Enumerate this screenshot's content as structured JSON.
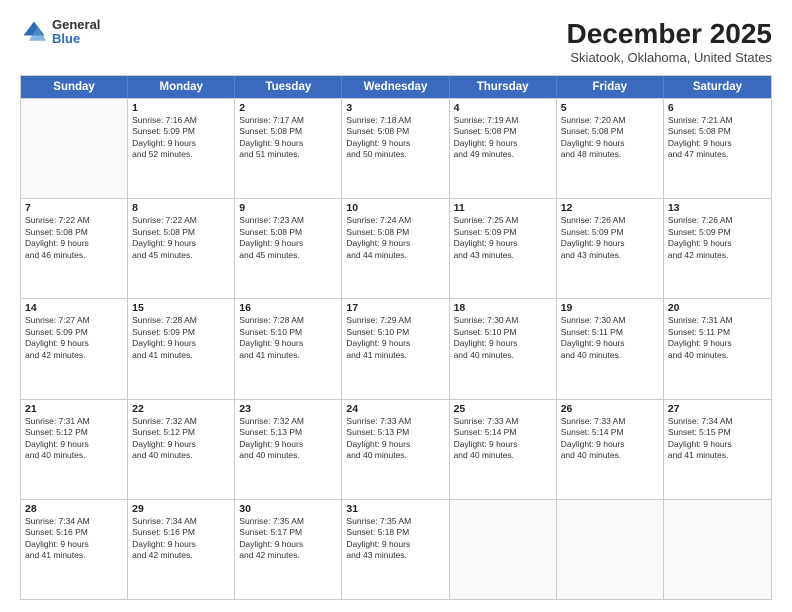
{
  "header": {
    "logo": {
      "general": "General",
      "blue": "Blue"
    },
    "title": "December 2025",
    "location": "Skiatook, Oklahoma, United States"
  },
  "weekdays": [
    "Sunday",
    "Monday",
    "Tuesday",
    "Wednesday",
    "Thursday",
    "Friday",
    "Saturday"
  ],
  "rows": [
    [
      {
        "day": "",
        "lines": []
      },
      {
        "day": "1",
        "lines": [
          "Sunrise: 7:16 AM",
          "Sunset: 5:09 PM",
          "Daylight: 9 hours",
          "and 52 minutes."
        ]
      },
      {
        "day": "2",
        "lines": [
          "Sunrise: 7:17 AM",
          "Sunset: 5:08 PM",
          "Daylight: 9 hours",
          "and 51 minutes."
        ]
      },
      {
        "day": "3",
        "lines": [
          "Sunrise: 7:18 AM",
          "Sunset: 5:08 PM",
          "Daylight: 9 hours",
          "and 50 minutes."
        ]
      },
      {
        "day": "4",
        "lines": [
          "Sunrise: 7:19 AM",
          "Sunset: 5:08 PM",
          "Daylight: 9 hours",
          "and 49 minutes."
        ]
      },
      {
        "day": "5",
        "lines": [
          "Sunrise: 7:20 AM",
          "Sunset: 5:08 PM",
          "Daylight: 9 hours",
          "and 48 minutes."
        ]
      },
      {
        "day": "6",
        "lines": [
          "Sunrise: 7:21 AM",
          "Sunset: 5:08 PM",
          "Daylight: 9 hours",
          "and 47 minutes."
        ]
      }
    ],
    [
      {
        "day": "7",
        "lines": [
          "Sunrise: 7:22 AM",
          "Sunset: 5:08 PM",
          "Daylight: 9 hours",
          "and 46 minutes."
        ]
      },
      {
        "day": "8",
        "lines": [
          "Sunrise: 7:22 AM",
          "Sunset: 5:08 PM",
          "Daylight: 9 hours",
          "and 45 minutes."
        ]
      },
      {
        "day": "9",
        "lines": [
          "Sunrise: 7:23 AM",
          "Sunset: 5:08 PM",
          "Daylight: 9 hours",
          "and 45 minutes."
        ]
      },
      {
        "day": "10",
        "lines": [
          "Sunrise: 7:24 AM",
          "Sunset: 5:08 PM",
          "Daylight: 9 hours",
          "and 44 minutes."
        ]
      },
      {
        "day": "11",
        "lines": [
          "Sunrise: 7:25 AM",
          "Sunset: 5:09 PM",
          "Daylight: 9 hours",
          "and 43 minutes."
        ]
      },
      {
        "day": "12",
        "lines": [
          "Sunrise: 7:26 AM",
          "Sunset: 5:09 PM",
          "Daylight: 9 hours",
          "and 43 minutes."
        ]
      },
      {
        "day": "13",
        "lines": [
          "Sunrise: 7:26 AM",
          "Sunset: 5:09 PM",
          "Daylight: 9 hours",
          "and 42 minutes."
        ]
      }
    ],
    [
      {
        "day": "14",
        "lines": [
          "Sunrise: 7:27 AM",
          "Sunset: 5:09 PM",
          "Daylight: 9 hours",
          "and 42 minutes."
        ]
      },
      {
        "day": "15",
        "lines": [
          "Sunrise: 7:28 AM",
          "Sunset: 5:09 PM",
          "Daylight: 9 hours",
          "and 41 minutes."
        ]
      },
      {
        "day": "16",
        "lines": [
          "Sunrise: 7:28 AM",
          "Sunset: 5:10 PM",
          "Daylight: 9 hours",
          "and 41 minutes."
        ]
      },
      {
        "day": "17",
        "lines": [
          "Sunrise: 7:29 AM",
          "Sunset: 5:10 PM",
          "Daylight: 9 hours",
          "and 41 minutes."
        ]
      },
      {
        "day": "18",
        "lines": [
          "Sunrise: 7:30 AM",
          "Sunset: 5:10 PM",
          "Daylight: 9 hours",
          "and 40 minutes."
        ]
      },
      {
        "day": "19",
        "lines": [
          "Sunrise: 7:30 AM",
          "Sunset: 5:11 PM",
          "Daylight: 9 hours",
          "and 40 minutes."
        ]
      },
      {
        "day": "20",
        "lines": [
          "Sunrise: 7:31 AM",
          "Sunset: 5:11 PM",
          "Daylight: 9 hours",
          "and 40 minutes."
        ]
      }
    ],
    [
      {
        "day": "21",
        "lines": [
          "Sunrise: 7:31 AM",
          "Sunset: 5:12 PM",
          "Daylight: 9 hours",
          "and 40 minutes."
        ]
      },
      {
        "day": "22",
        "lines": [
          "Sunrise: 7:32 AM",
          "Sunset: 5:12 PM",
          "Daylight: 9 hours",
          "and 40 minutes."
        ]
      },
      {
        "day": "23",
        "lines": [
          "Sunrise: 7:32 AM",
          "Sunset: 5:13 PM",
          "Daylight: 9 hours",
          "and 40 minutes."
        ]
      },
      {
        "day": "24",
        "lines": [
          "Sunrise: 7:33 AM",
          "Sunset: 5:13 PM",
          "Daylight: 9 hours",
          "and 40 minutes."
        ]
      },
      {
        "day": "25",
        "lines": [
          "Sunrise: 7:33 AM",
          "Sunset: 5:14 PM",
          "Daylight: 9 hours",
          "and 40 minutes."
        ]
      },
      {
        "day": "26",
        "lines": [
          "Sunrise: 7:33 AM",
          "Sunset: 5:14 PM",
          "Daylight: 9 hours",
          "and 40 minutes."
        ]
      },
      {
        "day": "27",
        "lines": [
          "Sunrise: 7:34 AM",
          "Sunset: 5:15 PM",
          "Daylight: 9 hours",
          "and 41 minutes."
        ]
      }
    ],
    [
      {
        "day": "28",
        "lines": [
          "Sunrise: 7:34 AM",
          "Sunset: 5:16 PM",
          "Daylight: 9 hours",
          "and 41 minutes."
        ]
      },
      {
        "day": "29",
        "lines": [
          "Sunrise: 7:34 AM",
          "Sunset: 5:16 PM",
          "Daylight: 9 hours",
          "and 42 minutes."
        ]
      },
      {
        "day": "30",
        "lines": [
          "Sunrise: 7:35 AM",
          "Sunset: 5:17 PM",
          "Daylight: 9 hours",
          "and 42 minutes."
        ]
      },
      {
        "day": "31",
        "lines": [
          "Sunrise: 7:35 AM",
          "Sunset: 5:18 PM",
          "Daylight: 9 hours",
          "and 43 minutes."
        ]
      },
      {
        "day": "",
        "lines": []
      },
      {
        "day": "",
        "lines": []
      },
      {
        "day": "",
        "lines": []
      }
    ]
  ]
}
